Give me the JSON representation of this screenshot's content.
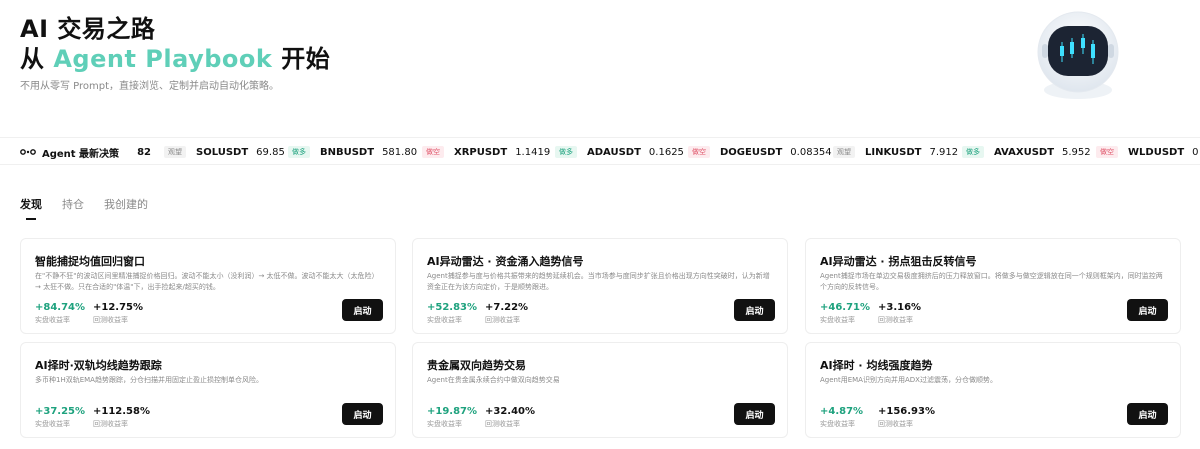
{
  "hero": {
    "title_line1": "AI 交易之路",
    "title_line2_prefix": "从 ",
    "title_line2_accent": "Agent Playbook",
    "title_line2_suffix": " 开始",
    "subtitle": "不用从零写 Prompt，直接浏览、定制并启动自动化策略。"
  },
  "ticker": {
    "lead_label": "Agent 最新决策",
    "lead_count": "82",
    "items": [
      {
        "badge": "观望",
        "badge_type": "neutral",
        "symbol": "SOLUSDT",
        "price": "69.85"
      },
      {
        "badge": "做多",
        "badge_type": "long",
        "symbol": "BNBUSDT",
        "price": "581.80"
      },
      {
        "badge": "做空",
        "badge_type": "short",
        "symbol": "XRPUSDT",
        "price": "1.1419"
      },
      {
        "badge": "做多",
        "badge_type": "long",
        "symbol": "ADAUSDT",
        "price": "0.1625"
      },
      {
        "badge": "做空",
        "badge_type": "short",
        "symbol": "DOGEUSDT",
        "price": "0.08354"
      },
      {
        "badge": "观望",
        "badge_type": "neutral",
        "symbol": "LINKUSDT",
        "price": "7.912"
      },
      {
        "badge": "做多",
        "badge_type": "long",
        "symbol": "AVAXUSDT",
        "price": "5.952"
      },
      {
        "badge": "做空",
        "badge_type": "short",
        "symbol": "WLDUSDT",
        "price": "0"
      }
    ]
  },
  "tabs": [
    "发现",
    "持仓",
    "我创建的"
  ],
  "cards": [
    {
      "title": "智能捕捉均值回归窗口",
      "desc": "在\"不静不狂\"的波动区间里精准捕捉价格回归。波动不能太小（没利润）→ 太低不做。波动不能太大（太危险）→ 太狂不做。只在合适的\"体温\"下，出手捡起来/超买的钱。",
      "live": "+84.74%",
      "back": "+12.75%"
    },
    {
      "title": "AI异动雷达 · 资金涌入趋势信号",
      "desc": "Agent捕捉参与度与价格共振带来的趋势延续机会。当市场参与度同步扩张且价格出现方向性突破时，认为新增资金正在为该方向定价，于是顺势跟进。",
      "live": "+52.83%",
      "back": "+7.22%"
    },
    {
      "title": "AI异动雷达 · 拐点狙击反转信号",
      "desc": "Agent捕捉市场在单边交易极度拥挤后的压力释放窗口。将做多与做空逻辑放在同一个规则框架内，同时监控两个方向的反转信号。",
      "live": "+46.71%",
      "back": "+3.16%"
    },
    {
      "title": "AI择时·双轨均线趋势跟踪",
      "desc": "多币种1H双轨EMA趋势跟踪，分仓扫描并用固定止盈止损控制单仓风险。",
      "live": "+37.25%",
      "back": "+112.58%"
    },
    {
      "title": "贵金属双向趋势交易",
      "desc": "Agent在贵金属永续合约中做双向趋势交易",
      "live": "+19.87%",
      "back": "+32.40%"
    },
    {
      "title": "AI择时 · 均线强度趋势",
      "desc": "Agent用EMA识别方向并用ADX过滤震荡，分仓做顺势。",
      "live": "+4.87%",
      "back": "+156.93%"
    }
  ],
  "labels": {
    "live": "实盘收益率",
    "back": "回测收益率",
    "start": "启动"
  },
  "colors": {
    "accent": "#5fcfb8",
    "long": "#1ea27e",
    "short": "#e0566b",
    "button": "#111111"
  }
}
